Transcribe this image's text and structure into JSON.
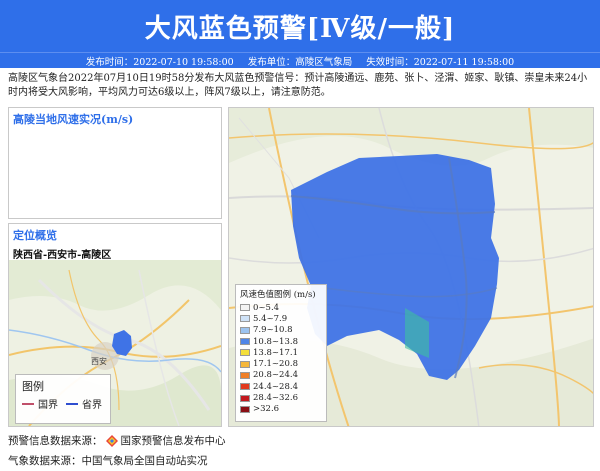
{
  "header": {
    "title": "大风蓝色预警[Ⅳ级/一般]",
    "issue_time": "发布时间：2022-07-10 19:58:00",
    "issuer": "发布单位：高陵区气象局",
    "expire_time": "失效时间：2022-07-11 19:58:00"
  },
  "description": "高陵区气象台2022年07月10日19时58分发布大风蓝色预警信号：预计高陵通远、鹿苑、张卜、泾渭、姬家、耿镇、崇皇未来24小时内将受大风影响，平均风力可达6级以上，阵风7级以上，请注意防范。",
  "wind_panel": {
    "title": "高陵当地风速实况(m/s)"
  },
  "locate_panel": {
    "title": "定位概览",
    "subtitle": "陕西省-西安市-高陵区",
    "legend": {
      "title": "图例",
      "items": [
        {
          "label": "国界",
          "color": "#c0506a"
        },
        {
          "label": "省界",
          "color": "#2f4fd0"
        }
      ]
    },
    "map_labels": [
      "西安"
    ]
  },
  "main_map": {
    "legend_title": "风速色值图例 (m/s)",
    "legend_items": [
      {
        "label": "0~5.4",
        "color": "#f4f4f4"
      },
      {
        "label": "5.4~7.9",
        "color": "#cfe2f7"
      },
      {
        "label": "7.9~10.8",
        "color": "#9cc3ef"
      },
      {
        "label": "10.8~13.8",
        "color": "#4f86e8"
      },
      {
        "label": "13.8~17.1",
        "color": "#f4df3a"
      },
      {
        "label": "17.1~20.8",
        "color": "#f5b73a"
      },
      {
        "label": "20.8~24.4",
        "color": "#ef7f28"
      },
      {
        "label": "24.4~28.4",
        "color": "#e23a1e"
      },
      {
        "label": "28.4~32.6",
        "color": "#c2181d"
      },
      {
        "label": ">32.6",
        "color": "#8a0f14"
      }
    ]
  },
  "footer": {
    "warn_source_label": "预警信息数据来源：",
    "warn_source": "国家预警信息发布中心",
    "weather_source_label": "气象数据来源：",
    "weather_source": "中国气象局全国自动站实况"
  },
  "colors": {
    "banner": "#2f6fe9",
    "alert_fill": "#3f73e6"
  }
}
